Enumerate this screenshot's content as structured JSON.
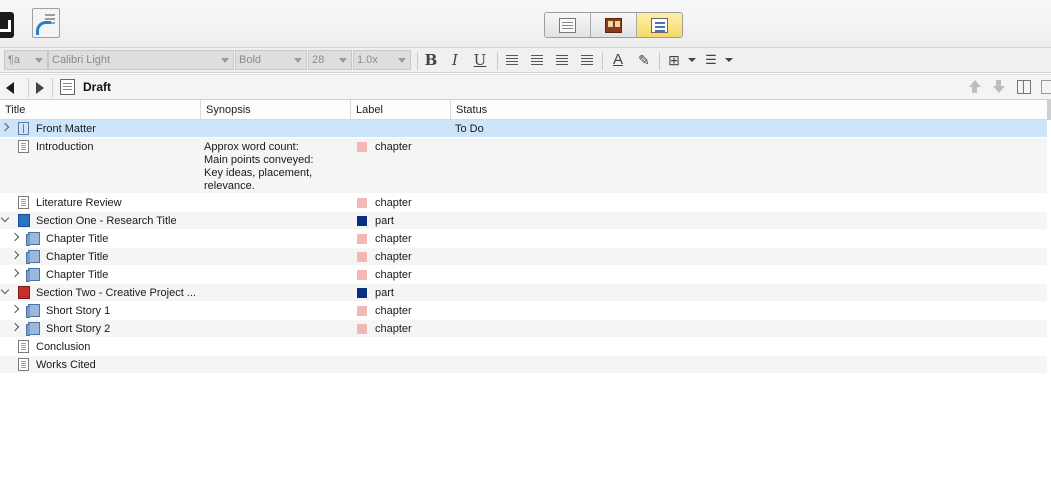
{
  "toolbar": {
    "icons": [
      "compile-icon",
      "share-icon"
    ],
    "view_modes": [
      "document",
      "corkboard",
      "outliner"
    ],
    "active_view": "outliner"
  },
  "format_bar": {
    "style": "¶a",
    "font": "Calibri Light",
    "weight": "Bold",
    "size": "28",
    "line_spacing": "1.0x"
  },
  "header": {
    "title": "Draft"
  },
  "outliner": {
    "columns": [
      "Title",
      "Synopsis",
      "Label",
      "Status"
    ],
    "rows": [
      {
        "title": "Front Matter",
        "synopsis": "",
        "label": "",
        "label_color": "",
        "status": "To Do",
        "icon": "front-matter-icon",
        "level": 0,
        "disclosure": "closed",
        "selected": true
      },
      {
        "title": "Introduction",
        "synopsis": "Approx word count:\nMain points conveyed:\nKey ideas, placement,\nrelevance.",
        "label": "chapter",
        "label_color": "#f4b7b3",
        "status": "",
        "icon": "document-icon",
        "level": 0,
        "disclosure": "none"
      },
      {
        "title": "Literature Review",
        "synopsis": "",
        "label": "chapter",
        "label_color": "#f4b7b3",
        "status": "",
        "icon": "document-icon",
        "level": 0,
        "disclosure": "none"
      },
      {
        "title": "Section One - Research Title",
        "synopsis": "",
        "label": "part",
        "label_color": "#0b2f80",
        "status": "",
        "icon": "blue-folder-icon",
        "level": 0,
        "disclosure": "open"
      },
      {
        "title": "Chapter Title",
        "synopsis": "",
        "label": "chapter",
        "label_color": "#f4b7b3",
        "status": "",
        "icon": "folder-stack-icon",
        "level": 1,
        "disclosure": "closed"
      },
      {
        "title": "Chapter Title",
        "synopsis": "",
        "label": "chapter",
        "label_color": "#f4b7b3",
        "status": "",
        "icon": "folder-stack-icon",
        "level": 1,
        "disclosure": "closed"
      },
      {
        "title": "Chapter Title",
        "synopsis": "",
        "label": "chapter",
        "label_color": "#f4b7b3",
        "status": "",
        "icon": "folder-stack-icon",
        "level": 1,
        "disclosure": "closed"
      },
      {
        "title": "Section Two - Creative Project ...",
        "synopsis": "",
        "label": "part",
        "label_color": "#0b2f80",
        "status": "",
        "icon": "red-folder-icon",
        "level": 0,
        "disclosure": "open"
      },
      {
        "title": "Short Story 1",
        "synopsis": "",
        "label": "chapter",
        "label_color": "#f4b7b3",
        "status": "",
        "icon": "folder-stack-icon",
        "level": 1,
        "disclosure": "closed"
      },
      {
        "title": "Short Story 2",
        "synopsis": "",
        "label": "chapter",
        "label_color": "#f4b7b3",
        "status": "",
        "icon": "folder-stack-icon",
        "level": 1,
        "disclosure": "closed"
      },
      {
        "title": "Conclusion",
        "synopsis": "",
        "label": "",
        "label_color": "",
        "status": "",
        "icon": "document-icon",
        "level": 0,
        "disclosure": "none"
      },
      {
        "title": "Works Cited",
        "synopsis": "",
        "label": "",
        "label_color": "",
        "status": "",
        "icon": "document-icon",
        "level": 0,
        "disclosure": "none"
      }
    ]
  }
}
